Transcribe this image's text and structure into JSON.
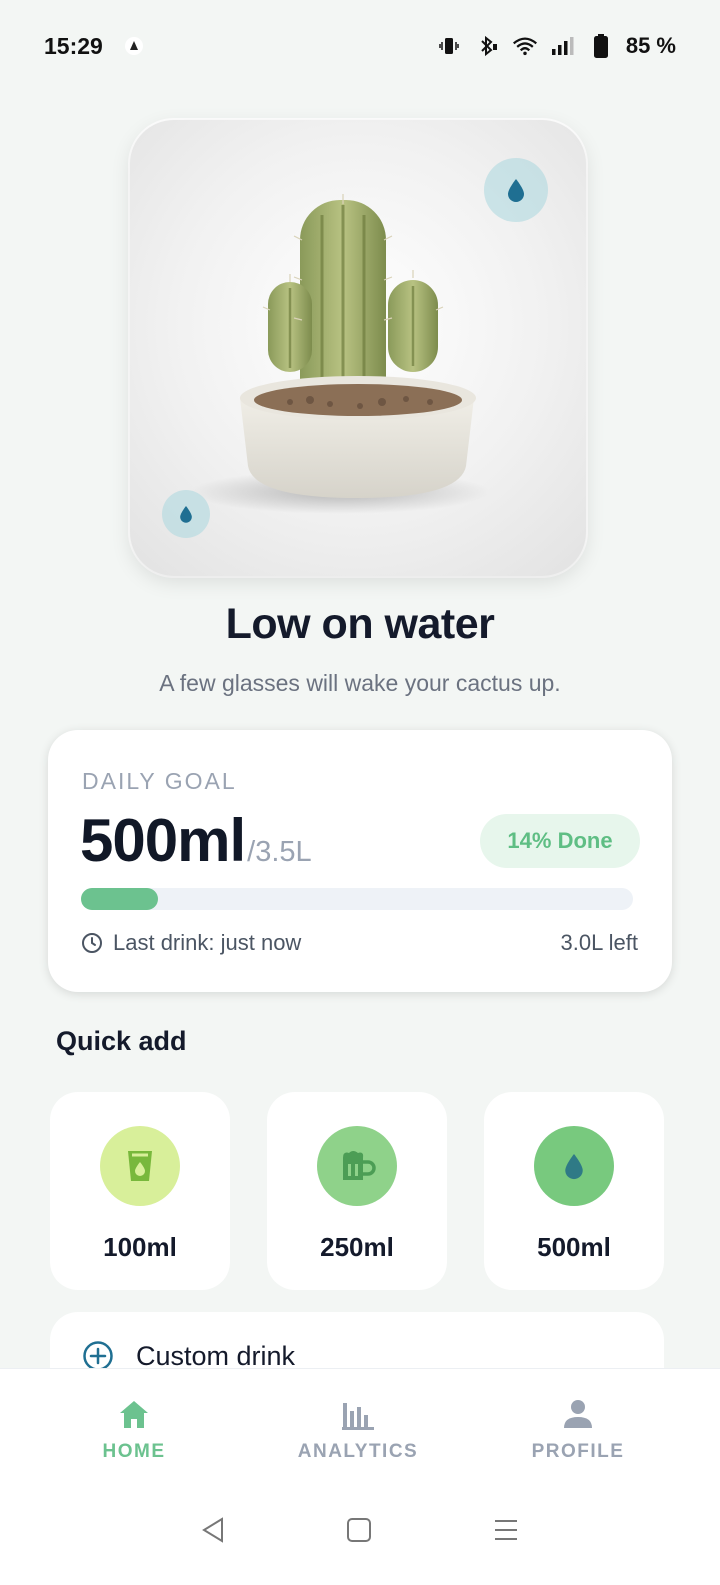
{
  "status_bar": {
    "time": "15:29",
    "battery": "85 %",
    "icons": [
      "notification-icon",
      "vibrate-icon",
      "bluetooth-icon",
      "wifi-icon",
      "signal-icon",
      "battery-icon"
    ]
  },
  "plant": {
    "status_title": "Low on water",
    "status_subtitle": "A few glasses will wake your cactus up."
  },
  "goal": {
    "label": "DAILY GOAL",
    "value": "500ml",
    "total": "/3.5L",
    "badge": "14% Done",
    "progress_fraction": 0.14,
    "last_drink": "Last drink: just now",
    "remaining": "3.0L left"
  },
  "quick_add": {
    "title": "Quick add",
    "items": [
      {
        "label": "100ml",
        "icon": "glass-icon",
        "color": "#d8ef9a",
        "icon_color": "#78b83c"
      },
      {
        "label": "250ml",
        "icon": "mug-icon",
        "color": "#8fd28a",
        "icon_color": "#4c9d55"
      },
      {
        "label": "500ml",
        "icon": "water-drop-icon",
        "color": "#78c97e",
        "icon_color": "#2f7a86"
      }
    ]
  },
  "custom": {
    "label": "Custom drink"
  },
  "nav": {
    "home": "HOME",
    "analytics": "ANALYTICS",
    "profile": "PROFILE"
  },
  "colors": {
    "accent": "#6cc28f",
    "background": "#f3f6f4",
    "nav_inactive": "#9aa3b2"
  }
}
